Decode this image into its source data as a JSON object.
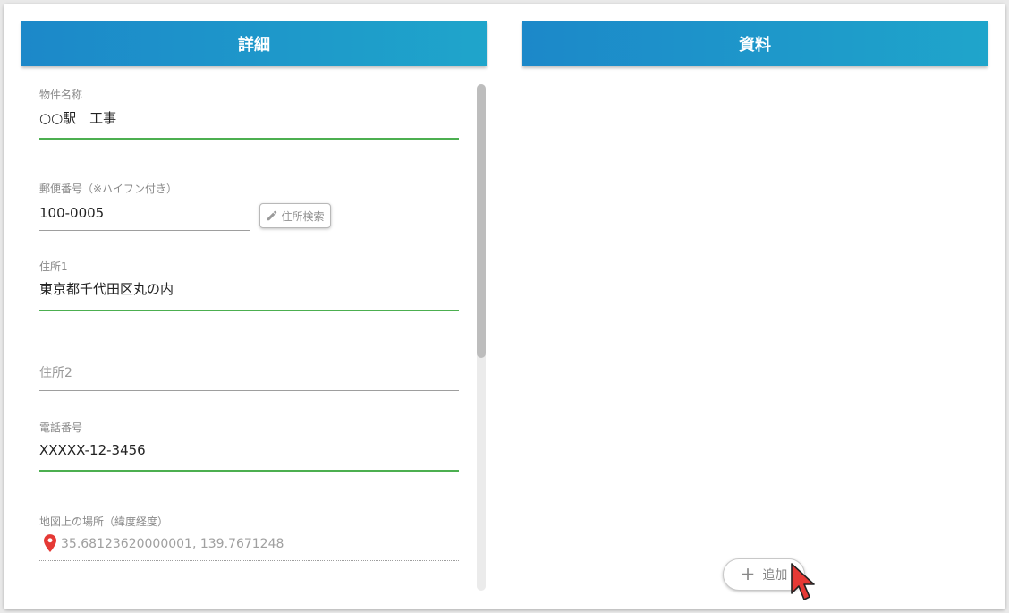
{
  "panels": {
    "details_title": "詳細",
    "materials_title": "資料"
  },
  "form": {
    "property_name": {
      "label": "物件名称",
      "value": "○○駅　工事"
    },
    "postal_code": {
      "label": "郵便番号（※ハイフン付き）",
      "value": "100-0005",
      "search_button": "住所検索"
    },
    "address1": {
      "label": "住所1",
      "value": "東京都千代田区丸の内"
    },
    "address2": {
      "placeholder": "住所2"
    },
    "phone": {
      "label": "電話番号",
      "value": "XXXXX-12-3456"
    },
    "map_location": {
      "label": "地図上の場所（緯度経度）",
      "value": "35.68123620000001, 139.7671248"
    }
  },
  "materials": {
    "add_button": "追加"
  },
  "colors": {
    "header_start": "#1c88c9",
    "header_end": "#1fa5cb",
    "valid_underline": "#4caf50",
    "pin": "#e53935",
    "cursor": "#e53935"
  },
  "icons": {
    "search_button_icon": "pencil-icon",
    "map_icon": "map-pin-icon",
    "add_icon": "plus-icon",
    "pointer": "cursor-pointer-icon"
  }
}
